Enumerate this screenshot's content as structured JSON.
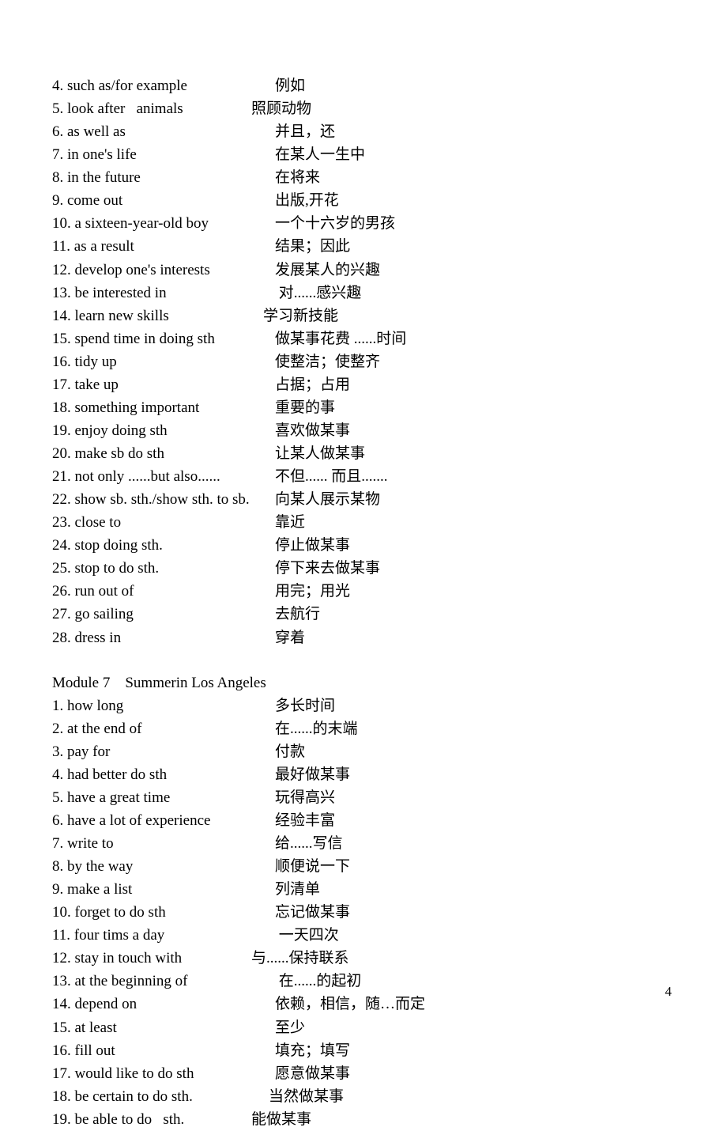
{
  "section1": {
    "items": [
      {
        "left": "4. such as/for example",
        "right": "例如"
      },
      {
        "left": "5. look after   animals",
        "right": "照顾动物",
        "rightOffset": -30
      },
      {
        "left": "6. as well as",
        "right": "并且，还"
      },
      {
        "left": "7. in one's life",
        "right": "在某人一生中"
      },
      {
        "left": "8. in the future",
        "right": "在将来"
      },
      {
        "left": "9. come out",
        "right": "出版,开花"
      },
      {
        "left": "10. a sixteen-year-old boy",
        "right": "一个十六岁的男孩"
      },
      {
        "left": "11. as a result",
        "right": "结果；因此"
      },
      {
        "left": "12. develop one's interests",
        "right": "发展某人的兴趣"
      },
      {
        "left": "13. be interested in",
        "right": " 对......感兴趣"
      },
      {
        "left": "14. learn new skills",
        "right": "学习新技能",
        "rightOffset": -15
      },
      {
        "left": "15. spend time in doing sth",
        "right": "做某事花费 ......时间"
      },
      {
        "left": "16. tidy up",
        "right": "使整洁；使整齐"
      },
      {
        "left": "17. take up",
        "right": "占据；占用"
      },
      {
        "left": "18. something important",
        "right": "重要的事"
      },
      {
        "left": "19. enjoy doing sth",
        "right": "喜欢做某事"
      },
      {
        "left": "20. make sb do sth",
        "right": "让某人做某事"
      },
      {
        "left": "21. not only ......but also......",
        "right": "不但...... 而且......."
      },
      {
        "left": "22. show sb. sth./show sth. to sb.",
        "right": "向某人展示某物"
      },
      {
        "left": "23. close to",
        "right": "靠近"
      },
      {
        "left": "24. stop doing sth.",
        "right": "停止做某事"
      },
      {
        "left": "25. stop to do sth.",
        "right": "停下来去做某事"
      },
      {
        "left": "26. run out of",
        "right": "用完；用光"
      },
      {
        "left": "27. go sailing",
        "right": "去航行"
      },
      {
        "left": "28. dress in",
        "right": "穿着"
      }
    ]
  },
  "section2": {
    "header": "Module 7    Summerin Los Angeles",
    "items": [
      {
        "left": "1. how long",
        "right": "多长时间"
      },
      {
        "left": "2. at the end of",
        "right": "在......的末端"
      },
      {
        "left": "3. pay for",
        "right": "付款"
      },
      {
        "left": "4. had better do sth",
        "right": "最好做某事"
      },
      {
        "left": "5. have a great time",
        "right": "玩得高兴"
      },
      {
        "left": "6. have a lot of experience",
        "right": "经验丰富"
      },
      {
        "left": "7. write to",
        "right": "给......写信"
      },
      {
        "left": "8. by the way",
        "right": "顺便说一下"
      },
      {
        "left": "9. make a list",
        "right": "列清单"
      },
      {
        "left": "10. forget to do sth",
        "right": "忘记做某事"
      },
      {
        "left": "11. four tims a day",
        "right": " 一天四次"
      },
      {
        "left": "12. stay in touch with",
        "right": "与......保持联系",
        "rightOffset": -30
      },
      {
        "left": "13. at the beginning of",
        "right": " 在......的起初"
      },
      {
        "left": "14. depend on",
        "right": "依赖，相信，随…而定"
      },
      {
        "left": "15. at least",
        "right": "至少"
      },
      {
        "left": "16. fill out",
        "right": "填充；填写"
      },
      {
        "left": "17. would like to do sth",
        "right": "愿意做某事"
      },
      {
        "left": "18. be certain to do sth.",
        "right": "当然做某事",
        "rightOffset": -8
      },
      {
        "left": "19. be able to do   sth.",
        "right": "能做某事",
        "rightOffset": -30
      }
    ]
  },
  "pageNumber": "4"
}
